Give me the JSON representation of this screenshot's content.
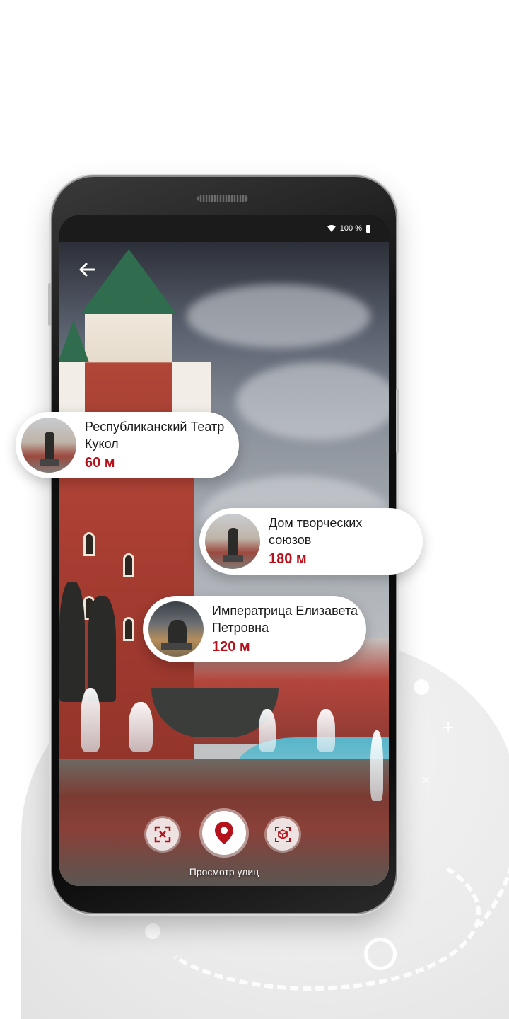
{
  "status_bar": {
    "battery_text": "100 %"
  },
  "back_button": {
    "icon": "arrow-left-icon"
  },
  "poi_cards": [
    {
      "name": "Республиканский Театр Кукол",
      "distance": "60 м",
      "thumb_icon": "statue-thumbnail"
    },
    {
      "name": "Дом творческих союзов",
      "distance": "180 м",
      "thumb_icon": "statue-thumbnail"
    },
    {
      "name": "Императрица Елизавета Петровна",
      "distance": "120 м",
      "thumb_icon": "monument-thumbnail"
    }
  ],
  "controls": {
    "left_icon": "qr-scan-icon",
    "main_icon": "map-pin-icon",
    "right_icon": "cube-3d-icon",
    "mode_label": "Просмотр улиц"
  },
  "colors": {
    "accent": "#b5121b",
    "card_bg": "#ffffff"
  }
}
